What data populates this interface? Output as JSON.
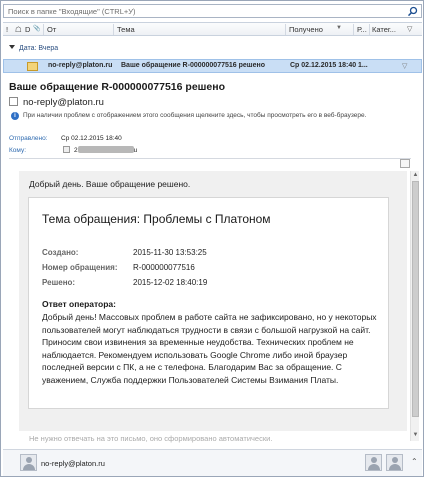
{
  "search": {
    "placeholder": "Поиск в папке \"Входящие\" (CTRL+У)"
  },
  "columns": {
    "icons": [
      "!",
      "☖",
      "D",
      "📎"
    ],
    "from": "От",
    "subject": "Тема",
    "received": "Получено",
    "size": "Р...",
    "category": "Катег..."
  },
  "group": {
    "label": "Дата: Вчера"
  },
  "mail_row": {
    "from": "no-reply@platon.ru",
    "subject": "Ваше обращение R-000000077516 решено",
    "received": "Ср 02.12.2015 18:40",
    "size": "1..."
  },
  "reading": {
    "subject": "Ваше обращение R-000000077516 решено",
    "sender": "no-reply@platon.ru",
    "info": "При наличии проблем с отображением этого сообщения щелкните здесь, чтобы просмотреть его в веб-браузере.",
    "sent_label": "Отправлено:",
    "sent_value": "Ср 02.12.2015 18:40",
    "to_label": "Кому:",
    "to_prefix": "2",
    "to_suffix": "u"
  },
  "email": {
    "greeting": "Добрый день. Ваше обращение решено.",
    "title": "Тема обращения: Проблемы с Платоном",
    "fields": [
      {
        "label": "Создано:",
        "value": "2015-11-30 13:53:25"
      },
      {
        "label": "Номер обращения:",
        "value": "R-000000077516"
      },
      {
        "label": "Решено:",
        "value": "2015-12-02 18:40:19"
      }
    ],
    "operator_label": "Ответ оператора:",
    "operator_text": "Добрый день! Массовых проблем в работе сайта не зафиксировано, но у некоторых пользователей могут наблюдаться трудности в связи с большой нагрузкой на сайт. Приносим свои извинения за временные неудобства. Технических проблем не наблюдается. Рекомендуем использовать Google Chrome либо иной браузер последней версии с ПК, а не с телефона. Благодарим Вас за обращение. С уважением, Служба поддержки Пользователей Системы Взимания Платы.",
    "footer": "Не нужно отвечать на это письмо, оно сформировано автоматически."
  },
  "people": {
    "name": "no-reply@platon.ru"
  },
  "colors": {
    "selection": "#c9def5",
    "link_blue": "#2f6bb0",
    "header_blue": "#2b4f81"
  }
}
